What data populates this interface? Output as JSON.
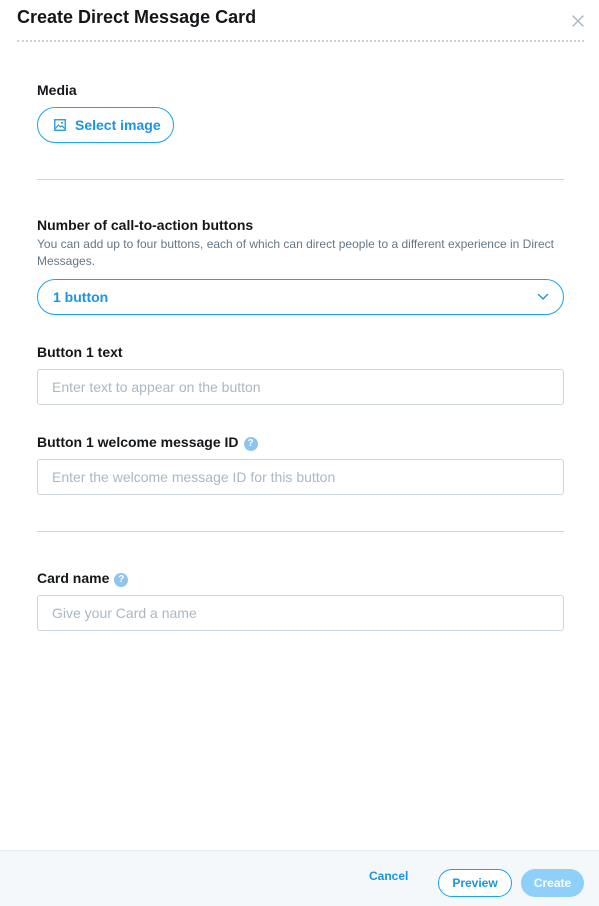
{
  "dialog": {
    "title": "Create Direct Message Card",
    "close_icon": "close-icon"
  },
  "media": {
    "label": "Media",
    "button_label": "Select image",
    "button_icon": "image-icon"
  },
  "cta": {
    "label": "Number of call-to-action buttons",
    "description": "You can add up to four buttons, each of which can direct people to a different experience in Direct Messages.",
    "selected": "1 button",
    "dropdown_icon": "chevron-down-icon"
  },
  "button1_text": {
    "label": "Button 1 text",
    "placeholder": "Enter text to appear on the button",
    "value": ""
  },
  "button1_welcome": {
    "label": "Button 1 welcome message ID",
    "help_icon": "help-icon",
    "help_glyph": "?",
    "placeholder": "Enter the welcome message ID for this button",
    "value": ""
  },
  "card_name": {
    "label": "Card name",
    "help_icon": "help-icon",
    "help_glyph": "?",
    "placeholder": "Give your Card a name",
    "value": ""
  },
  "footer": {
    "cancel_label": "Cancel",
    "preview_label": "Preview",
    "create_label": "Create"
  },
  "colors": {
    "accent": "#1da1f2",
    "accent_text": "#1b95e0",
    "create_disabled": "#8ed0f9",
    "help_badge": "#8ec4ee",
    "divider": "#ccd6dd",
    "footer_bg": "#f5f8fa"
  }
}
